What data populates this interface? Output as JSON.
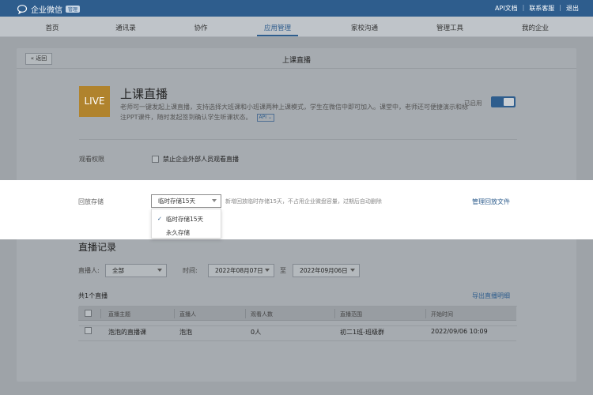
{
  "topbar": {
    "logo_text": "企业微信",
    "badge": "管理",
    "links": [
      "API文档",
      "联系客服",
      "退出"
    ]
  },
  "nav": {
    "items": [
      "首页",
      "通讯录",
      "协作",
      "应用管理",
      "家校沟通",
      "管理工具",
      "我的企业"
    ],
    "active": "应用管理"
  },
  "panel": {
    "back_label": "« 返回",
    "title": "上课直播"
  },
  "app": {
    "logo_text": "LIVE",
    "name": "上课直播",
    "description": "老师可一键发起上课直播，支持选择大班课和小班课两种上课模式，学生在微信中即可加入。课堂中，老师还可便捷演示和标注PPT课件，随时发起签到确认学生听课状态。",
    "api_tag": "API ⌄",
    "status": "已启用",
    "enabled": true
  },
  "settings": {
    "permission_label": "观看权限",
    "permission_option": "禁止企业外部人员观看直播",
    "storage_label": "回放存储",
    "storage_selected": "临时存储15天",
    "storage_options": [
      "临时存储15天",
      "永久存储"
    ],
    "storage_hint": "新增回放临时存储15天，不占用企业微盘容量，过期后自动删除",
    "manage_link": "管理回放文件"
  },
  "records": {
    "title": "直播记录",
    "host_label": "直播人:",
    "host_value": "全部",
    "time_label": "时间:",
    "date_from": "2022年08月07日",
    "to_label": "至",
    "date_to": "2022年09月06日",
    "count_text": "共1个直播",
    "export_label": "导出直播明细",
    "columns": [
      "直播主题",
      "直播人",
      "观看人数",
      "直播范围",
      "开始时间"
    ],
    "rows": [
      [
        "泡泡的直播课",
        "泡泡",
        "0人",
        "初二1班-班级群",
        "2022/09/06 10:09"
      ]
    ]
  },
  "colors": {
    "brand": "#2e5d8d",
    "live_logo": "#b0832d"
  }
}
